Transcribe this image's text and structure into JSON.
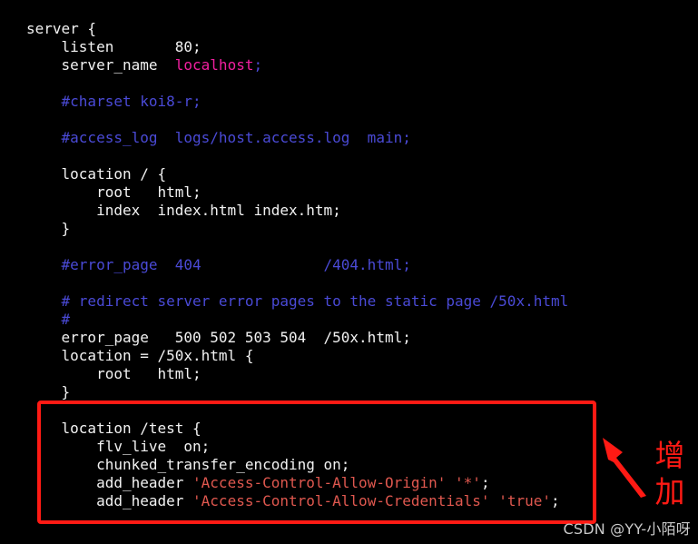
{
  "editor": {
    "background": "#000000",
    "foreground": "#f2f2f2",
    "comment_color": "#4a4ad6",
    "string_color": "#e0584f",
    "value_color": "#f21fa0",
    "lines": [
      {
        "id": "line-1",
        "segments": [
          {
            "t": "server {",
            "c": "plain"
          }
        ]
      },
      {
        "id": "line-2",
        "segments": [
          {
            "t": "    listen       80;",
            "c": "plain"
          }
        ]
      },
      {
        "id": "line-3",
        "segments": [
          {
            "t": "    server_name  ",
            "c": "plain"
          },
          {
            "t": "localhost",
            "c": "value"
          },
          {
            "t": ";",
            "c": "punct"
          }
        ]
      },
      {
        "id": "line-4",
        "segments": [
          {
            "t": "",
            "c": "plain"
          }
        ]
      },
      {
        "id": "line-5",
        "segments": [
          {
            "t": "    #charset koi8-r;",
            "c": "comment"
          }
        ]
      },
      {
        "id": "line-6",
        "segments": [
          {
            "t": "",
            "c": "plain"
          }
        ]
      },
      {
        "id": "line-7",
        "segments": [
          {
            "t": "    #access_log  logs/host.access.log  main;",
            "c": "comment"
          }
        ]
      },
      {
        "id": "line-8",
        "segments": [
          {
            "t": "",
            "c": "plain"
          }
        ]
      },
      {
        "id": "line-9",
        "segments": [
          {
            "t": "    location / {",
            "c": "plain"
          }
        ]
      },
      {
        "id": "line-10",
        "segments": [
          {
            "t": "        root   html;",
            "c": "plain"
          }
        ]
      },
      {
        "id": "line-11",
        "segments": [
          {
            "t": "        index  index.html index.htm;",
            "c": "plain"
          }
        ]
      },
      {
        "id": "line-12",
        "segments": [
          {
            "t": "    }",
            "c": "plain"
          }
        ]
      },
      {
        "id": "line-13",
        "segments": [
          {
            "t": "",
            "c": "plain"
          }
        ]
      },
      {
        "id": "line-14",
        "segments": [
          {
            "t": "    #error_page  404              /404.html;",
            "c": "comment"
          }
        ]
      },
      {
        "id": "line-15",
        "segments": [
          {
            "t": "",
            "c": "plain"
          }
        ]
      },
      {
        "id": "line-16",
        "segments": [
          {
            "t": "    # redirect server error pages to the static page /50x.html",
            "c": "comment"
          }
        ]
      },
      {
        "id": "line-17",
        "segments": [
          {
            "t": "    #",
            "c": "comment"
          }
        ]
      },
      {
        "id": "line-18",
        "segments": [
          {
            "t": "    error_page   500 502 503 504  /50x.html;",
            "c": "plain"
          }
        ]
      },
      {
        "id": "line-19",
        "segments": [
          {
            "t": "    location = /50x.html {",
            "c": "plain"
          }
        ]
      },
      {
        "id": "line-20",
        "segments": [
          {
            "t": "        root   html;",
            "c": "plain"
          }
        ]
      },
      {
        "id": "line-21",
        "segments": [
          {
            "t": "    }",
            "c": "plain"
          }
        ]
      },
      {
        "id": "line-22",
        "segments": [
          {
            "t": "",
            "c": "plain"
          }
        ]
      },
      {
        "id": "line-23",
        "segments": [
          {
            "t": "    location /test {",
            "c": "plain"
          }
        ]
      },
      {
        "id": "line-24",
        "segments": [
          {
            "t": "        flv_live  on;",
            "c": "plain"
          }
        ]
      },
      {
        "id": "line-25",
        "segments": [
          {
            "t": "        chunked_transfer_encoding on;",
            "c": "plain"
          }
        ]
      },
      {
        "id": "line-26",
        "segments": [
          {
            "t": "        add_header ",
            "c": "plain"
          },
          {
            "t": "'Access-Control-Allow-Origin'",
            "c": "string"
          },
          {
            "t": " ",
            "c": "plain"
          },
          {
            "t": "'*'",
            "c": "string"
          },
          {
            "t": ";",
            "c": "plain"
          }
        ]
      },
      {
        "id": "line-27",
        "segments": [
          {
            "t": "        add_header ",
            "c": "plain"
          },
          {
            "t": "'Access-Control-Allow-Credentials'",
            "c": "string"
          },
          {
            "t": " ",
            "c": "plain"
          },
          {
            "t": "'true'",
            "c": "string"
          },
          {
            "t": ";",
            "c": "plain"
          }
        ]
      }
    ]
  },
  "annotation": {
    "box_color": "#ff1a14",
    "arrow_color": "#ff1a14",
    "label_text": "增\n加",
    "label_color": "#ff1a14"
  },
  "watermark": {
    "text": "CSDN @YY-小陌呀",
    "color": "#c9c9c9"
  }
}
